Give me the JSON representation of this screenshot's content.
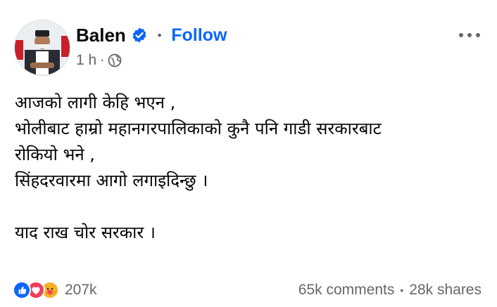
{
  "post": {
    "author_name": "Balen",
    "follow_label": "Follow",
    "dot": "•",
    "time": "1 h",
    "time_sep": "·",
    "icons": {
      "verified": "verified-badge-icon",
      "privacy": "globe-icon",
      "more": "more-options-icon"
    },
    "lines": [
      "आजको लागी केहि भएन ,",
      "भोलीबाट हाम्रो महानगरपालिकाको कुनै पनि गाडी सरकारबाट",
      "रोकियो भने ,",
      "सिंहदरवारमा आगो लगाइदिन्छु ।",
      "",
      "याद राख चोर सरकार ।"
    ]
  },
  "footer": {
    "reactions": [
      "like",
      "love",
      "care"
    ],
    "reaction_count": "207k",
    "comments": "65k comments",
    "bullet": "•",
    "shares": "28k shares"
  },
  "colors": {
    "accent": "#0866ff",
    "secondary_text": "#65676b",
    "like": "#0866ff",
    "love": "#f33e58",
    "care": "#f7b125"
  }
}
